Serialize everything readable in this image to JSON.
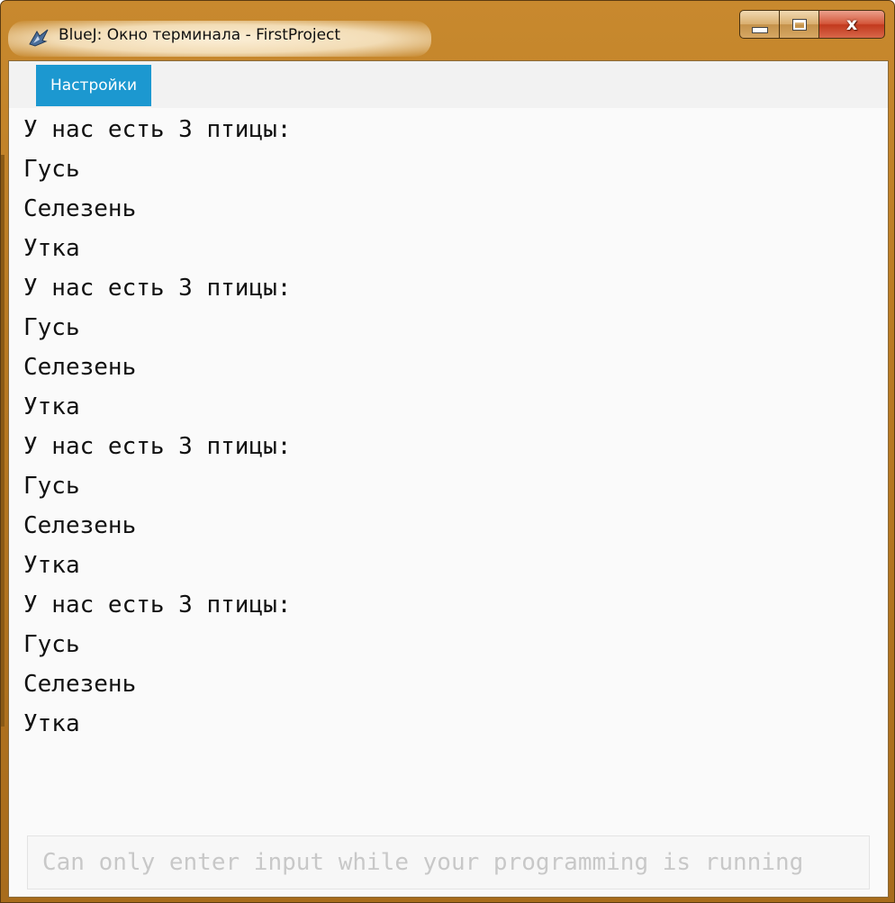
{
  "window": {
    "title": "BlueJ: Окно терминала - FirstProject",
    "accent_color": "#b97a22",
    "controls": {
      "minimize_icon": "minimize-icon",
      "maximize_icon": "maximize-icon",
      "close_icon": "close-icon",
      "close_glyph": "x"
    }
  },
  "menu": {
    "settings_label": "Настройки",
    "settings_color": "#1c98d0"
  },
  "terminal": {
    "lines": [
      "У нас есть 3 птицы:",
      "Гусь",
      "Селезень",
      "Утка",
      "У нас есть 3 птицы:",
      "Гусь",
      "Селезень",
      "Утка",
      "У нас есть 3 птицы:",
      "Гусь",
      "Селезень",
      "Утка",
      "У нас есть 3 птицы:",
      "Гусь",
      "Селезень",
      "Утка"
    ]
  },
  "input": {
    "value": "",
    "placeholder": "Can only enter input while your programming is running"
  }
}
